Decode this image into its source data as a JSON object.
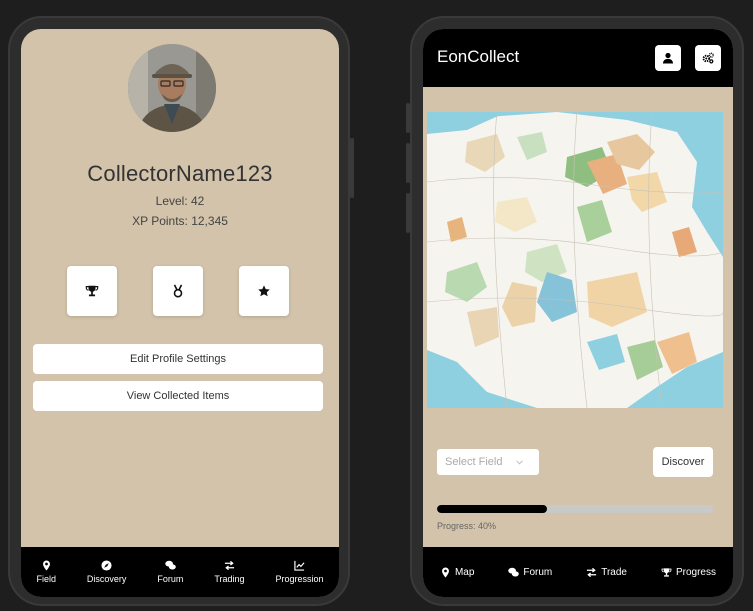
{
  "profile": {
    "username": "CollectorName123",
    "level_text": "Level: 42",
    "xp_text": "XP Points: 12,345",
    "buttons": {
      "edit": "Edit Profile Settings",
      "view": "View Collected Items"
    }
  },
  "left_nav": [
    {
      "label": "Field",
      "icon": "map-pin-icon"
    },
    {
      "label": "Discovery",
      "icon": "compass-icon"
    },
    {
      "label": "Forum",
      "icon": "comments-icon"
    },
    {
      "label": "Trading",
      "icon": "exchange-icon"
    },
    {
      "label": "Progression",
      "icon": "chart-icon"
    }
  ],
  "app": {
    "title": "EonCollect",
    "select_placeholder": "Select Field",
    "discover_label": "Discover",
    "progress_text": "Progress: 40%",
    "progress_value": 0.4
  },
  "right_nav": [
    {
      "label": "Map",
      "icon": "map-pin-icon"
    },
    {
      "label": "Forum",
      "icon": "comments-icon"
    },
    {
      "label": "Trade",
      "icon": "exchange-icon"
    },
    {
      "label": "Progress",
      "icon": "trophy-icon"
    }
  ],
  "colors": {
    "screen_bg": "#d2c3aa",
    "bar_bg": "#000000",
    "page_bg": "#1e1e1e"
  }
}
